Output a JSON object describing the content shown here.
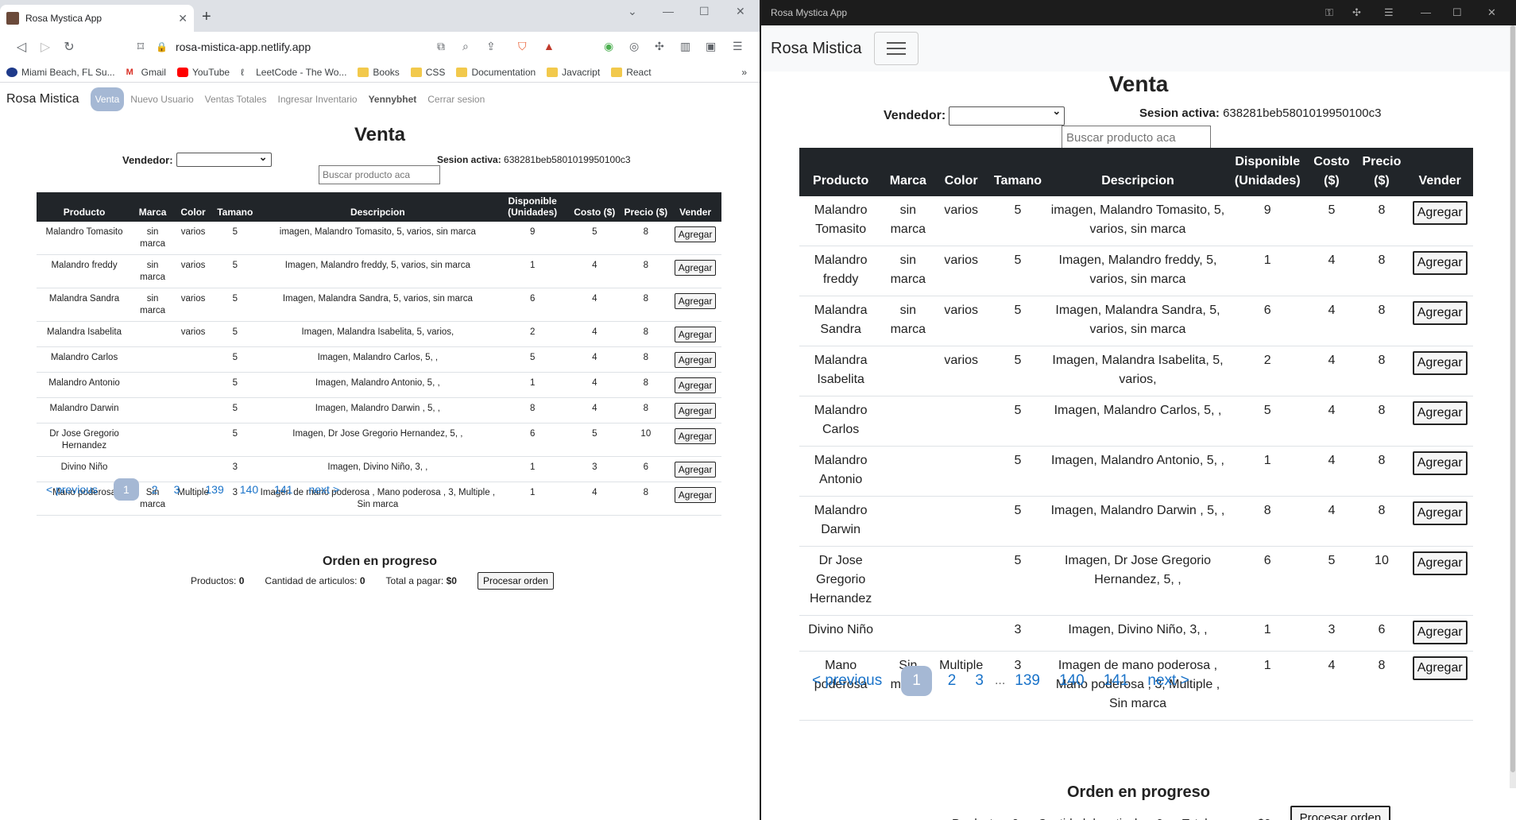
{
  "browser": {
    "tab_title": "Rosa Mystica App",
    "url": "rosa-mistica-app.netlify.app",
    "bookmarks": [
      "Miami Beach, FL Su...",
      "Gmail",
      "YouTube",
      "LeetCode - The Wo...",
      "Books",
      "CSS",
      "Documentation",
      "Javacript",
      "React"
    ]
  },
  "app_window": {
    "title": "Rosa Mystica App"
  },
  "nav": {
    "brand": "Rosa Mistica",
    "links": [
      "Venta",
      "Nuevo Usuario",
      "Ventas Totales",
      "Ingresar Inventario",
      "Yennybhet",
      "Cerrar sesion"
    ]
  },
  "page": {
    "title": "Venta",
    "vendedor_label": "Vendedor:",
    "vendedor_value": "",
    "session_label": "Sesion activa:",
    "session_id": "638281beb5801019950100c3",
    "search_placeholder": "Buscar producto aca"
  },
  "table": {
    "headers": [
      "Producto",
      "Marca",
      "Color",
      "Tamano",
      "Descripcion",
      "Disponible (Unidades)",
      "Costo ($)",
      "Precio ($)",
      "Vender"
    ],
    "button_label": "Agregar",
    "rows": [
      {
        "producto": "Malandro Tomasito",
        "marca": "sin marca",
        "color": "varios",
        "tamano": "5",
        "descripcion": "imagen, Malandro Tomasito, 5, varios, sin marca",
        "disponible": "9",
        "costo": "5",
        "precio": "8"
      },
      {
        "producto": "Malandro freddy",
        "marca": "sin marca",
        "color": "varios",
        "tamano": "5",
        "descripcion": "Imagen, Malandro freddy, 5, varios, sin marca",
        "disponible": "1",
        "costo": "4",
        "precio": "8"
      },
      {
        "producto": "Malandra Sandra",
        "marca": "sin marca",
        "color": "varios",
        "tamano": "5",
        "descripcion": "Imagen, Malandra Sandra, 5, varios, sin marca",
        "disponible": "6",
        "costo": "4",
        "precio": "8"
      },
      {
        "producto": "Malandra Isabelita",
        "marca": "",
        "color": "varios",
        "tamano": "5",
        "descripcion": "Imagen, Malandra Isabelita, 5, varios,",
        "disponible": "2",
        "costo": "4",
        "precio": "8"
      },
      {
        "producto": "Malandro Carlos",
        "marca": "",
        "color": "",
        "tamano": "5",
        "descripcion": "Imagen, Malandro Carlos, 5, ,",
        "disponible": "5",
        "costo": "4",
        "precio": "8"
      },
      {
        "producto": "Malandro Antonio",
        "marca": "",
        "color": "",
        "tamano": "5",
        "descripcion": "Imagen, Malandro Antonio, 5, ,",
        "disponible": "1",
        "costo": "4",
        "precio": "8"
      },
      {
        "producto": "Malandro Darwin",
        "marca": "",
        "color": "",
        "tamano": "5",
        "descripcion": "Imagen, Malandro Darwin , 5, ,",
        "disponible": "8",
        "costo": "4",
        "precio": "8"
      },
      {
        "producto": "Dr Jose Gregorio Hernandez",
        "marca": "",
        "color": "",
        "tamano": "5",
        "descripcion": "Imagen, Dr Jose Gregorio Hernandez, 5, ,",
        "disponible": "6",
        "costo": "5",
        "precio": "10"
      },
      {
        "producto": "Divino Niño",
        "marca": "",
        "color": "",
        "tamano": "3",
        "descripcion": "Imagen, Divino Niño, 3, ,",
        "disponible": "1",
        "costo": "3",
        "precio": "6"
      },
      {
        "producto": "Mano poderosa",
        "marca": "Sin marca",
        "color": "Multiple",
        "tamano": "3",
        "descripcion": "Imagen de mano poderosa , Mano poderosa , 3, Multiple , Sin marca",
        "disponible": "1",
        "costo": "4",
        "precio": "8"
      }
    ]
  },
  "pagination": {
    "previous": "< previous",
    "pages": [
      "1",
      "2",
      "3",
      "139",
      "140",
      "141"
    ],
    "current": "1",
    "ellipsis": "...",
    "next": "next >"
  },
  "order": {
    "title": "Orden en progreso",
    "productos_label": "Productos:",
    "productos_value": "0",
    "cantidad_label": "Cantidad de articulos:",
    "cantidad_value": "0",
    "total_label": "Total a pagar:",
    "total_value": "$0",
    "process_label": "Procesar orden"
  },
  "colors": {
    "active_pill": "#a5b8d4",
    "table_header": "#212529",
    "link": "#1a73c9"
  }
}
